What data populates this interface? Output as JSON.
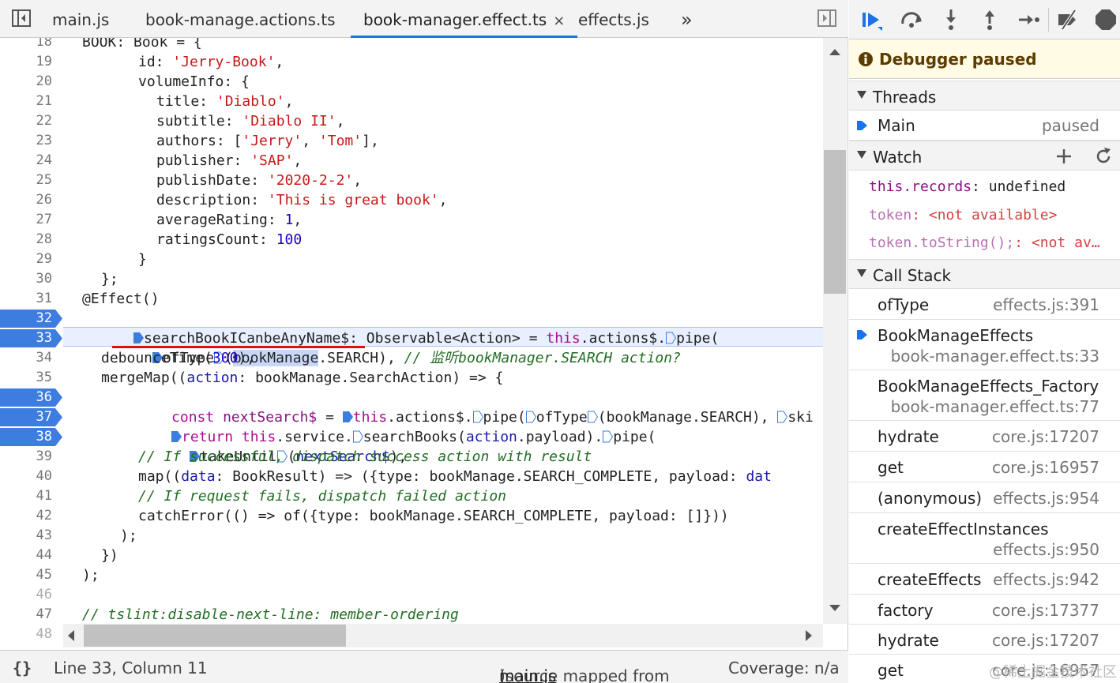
{
  "tabs": [
    {
      "label": "main.js"
    },
    {
      "label": "book-manage.actions.ts"
    },
    {
      "label": "book-manager.effect.ts",
      "close": "×"
    },
    {
      "label": "effects.js"
    }
  ],
  "tabs_more": "»",
  "gutter": [
    "18",
    "19",
    "20",
    "21",
    "22",
    "23",
    "24",
    "25",
    "26",
    "27",
    "28",
    "29",
    "30",
    "31",
    "32",
    "33",
    "34",
    "35",
    "36",
    "37",
    "38",
    "39",
    "40",
    "41",
    "42",
    "43",
    "44",
    "45",
    "46",
    "47",
    "48"
  ],
  "breakpoint_lines": [
    "32",
    "33",
    "36",
    "37",
    "38"
  ],
  "code": {
    "l18": "BOOK: Book = {",
    "l19_key": "id: ",
    "l19_val": "'Jerry-Book'",
    "l19_end": ",",
    "l20": "volumeInfo: {",
    "l21_key": "title: ",
    "l21_val": "'Diablo'",
    "l21_end": ",",
    "l22_key": "subtitle: ",
    "l22_val": "'Diablo II'",
    "l22_end": ",",
    "l23_key": "authors: [",
    "l23_v1": "'Jerry'",
    "l23_mid": ", ",
    "l23_v2": "'Tom'",
    "l23_end": "],",
    "l24_key": "publisher: ",
    "l24_val": "'SAP'",
    "l24_end": ",",
    "l25_key": "publishDate: ",
    "l25_val": "'2020-2-2'",
    "l25_end": ",",
    "l26_key": "description: ",
    "l26_val": "'This is great book'",
    "l26_end": ",",
    "l27_key": "averageRating: ",
    "l27_val": "1",
    "l27_end": ",",
    "l28_key": "ratingsCount: ",
    "l28_val": "100",
    "l29": "}",
    "l30": "};",
    "l31": "@Effect()",
    "l32_a": "searchBookICanbeAnyName$: Observable<Action> = ",
    "l32_this": "this",
    "l32_b": ".actions$.",
    "l32_c": "pipe(",
    "l33_a": "ofType",
    "l33_b": "(",
    "l33_sel": "bookManage",
    "l33_c": ".SEARCH), ",
    "l33_comment": "// 监听bookManager.SEARCH action?",
    "l34_a": "debounceTime(",
    "l34_n": "300",
    "l34_b": "),",
    "l35_a": "mergeMap((",
    "l35_v": "action",
    "l35_b": ": bookManage.SearchAction) => {",
    "l36_const": "const ",
    "l36_var": "nextSearch$",
    "l36_a": " = ",
    "l36_this": "this",
    "l36_b": ".actions$.",
    "l36_c": "pipe(",
    "l36_d": "ofType",
    "l36_e": "(bookManage.SEARCH), ",
    "l36_f": "ski",
    "l37_ret": "return ",
    "l37_this": "this",
    "l37_a": ".service.",
    "l37_b": "searchBooks(",
    "l37_v": "action",
    "l37_c": ".payload).",
    "l37_d": "pipe(",
    "l38_a": "takeUntil",
    "l38_b": "(",
    "l38_v": "nextSearch$",
    "l38_c": "),",
    "l39": "// If successful, dispatch success action with result",
    "l40_a": "map((",
    "l40_v": "data",
    "l40_b": ": BookResult) => ({type: bookManage.SEARCH_COMPLETE, payload: ",
    "l40_c": "dat",
    "l41": "// If request fails, dispatch failed action",
    "l42": "catchError(() => of({type: bookManage.SEARCH_COMPLETE, payload: []}))",
    "l43": ");",
    "l44": "})",
    "l45": ");",
    "l47": "// tslint:disable-next-line: member-ordering"
  },
  "status": {
    "braces": "{}",
    "position": "Line 33, Column 11",
    "source_prefix": "(source mapped from ",
    "source_link": "main.js",
    "source_suffix": ")",
    "coverage": "Coverage: n/a"
  },
  "debugger": {
    "paused_label": "Debugger paused",
    "threads_title": "Threads",
    "thread_name": "Main",
    "thread_state": "paused",
    "watch_title": "Watch",
    "watch": [
      {
        "expr": "this.records",
        "sep": ": ",
        "value": "undefined"
      },
      {
        "expr": "token",
        "sep": ": ",
        "value": "<not available>"
      },
      {
        "expr": "token.toString();",
        "sep": ": ",
        "value": "<not av…"
      }
    ],
    "callstack_title": "Call Stack",
    "frames": [
      {
        "name": "ofType",
        "loc": "effects.js:391"
      },
      {
        "name": "BookManageEffects",
        "loc": "book-manager.effect.ts:33"
      },
      {
        "name": "BookManageEffects_Factory",
        "loc": "book-manager.effect.ts:77"
      },
      {
        "name": "hydrate",
        "loc": "core.js:17207"
      },
      {
        "name": "get",
        "loc": "core.js:16957"
      },
      {
        "name": "(anonymous)",
        "loc": "effects.js:954"
      },
      {
        "name": "createEffectInstances",
        "loc": "effects.js:950"
      },
      {
        "name": "createEffects",
        "loc": "effects.js:942"
      },
      {
        "name": "factory",
        "loc": "core.js:17377"
      },
      {
        "name": "hydrate",
        "loc": "core.js:17207"
      },
      {
        "name": "get",
        "loc": "core.js:16957"
      }
    ]
  },
  "watermark": "@稀土掘金技术社区",
  "colors": {
    "accent": "#1a73e8",
    "breakpoint": "#3d7de0",
    "paused_bg": "#fffbe5"
  }
}
